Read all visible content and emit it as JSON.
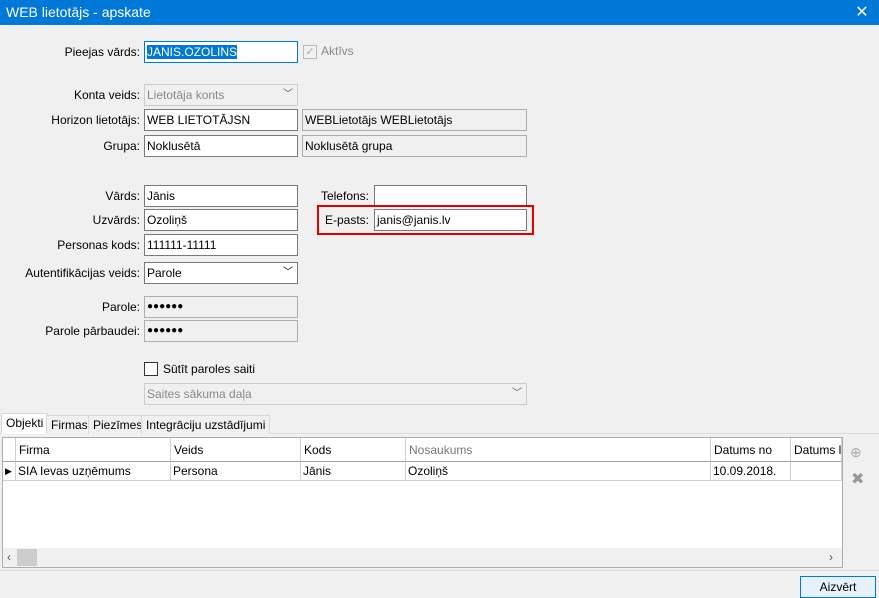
{
  "window": {
    "title": "WEB lietotājs - apskate",
    "close": "✕"
  },
  "form": {
    "login_label": "Pieejas vārds:",
    "login_value": "JANIS.OZOLINS",
    "active_label": "Aktīvs",
    "active_checked": true,
    "account_type_label": "Konta veids:",
    "account_type_value": "Lietotāja konts",
    "horizon_user_label": "Horizon lietotājs:",
    "horizon_user_value": "WEB LIETOTĀJSN",
    "horizon_user_name": "WEBLietotājs WEBLietotājs",
    "group_label": "Grupa:",
    "group_value": "Noklusētā",
    "group_name": "Noklusētā grupa",
    "first_name_label": "Vārds:",
    "first_name_value": "Jānis",
    "last_name_label": "Uzvārds:",
    "last_name_value": "Ozoliņš",
    "personal_code_label": "Personas kods:",
    "personal_code_value": "111111-11111",
    "auth_type_label": "Autentifikācijas veids:",
    "auth_type_value": "Parole",
    "password_label": "Parole:",
    "password_value": "●●●●●●",
    "password_confirm_label": "Parole pārbaudei:",
    "password_confirm_value": "●●●●●●",
    "phone_label": "Telefons:",
    "phone_value": "",
    "email_label": "E-pasts:",
    "email_value": "janis@janis.lv",
    "send_link_label": "Sūtīt paroles saiti",
    "send_link_checked": false,
    "start_page_placeholder": "Saites sākuma daļa"
  },
  "tabs": [
    "Objekti",
    "Firmas",
    "Piezīmes",
    "Integrāciju uzstādījumi"
  ],
  "grid": {
    "columns": [
      "Firma",
      "Veids",
      "Kods",
      "Nosaukums",
      "Datums no",
      "Datums līdz"
    ],
    "rows": [
      [
        "SIA Ievas uzņēmums",
        "Persona",
        "Jānis",
        "Ozoliņš",
        "10.09.2018.",
        ""
      ]
    ]
  },
  "footer": {
    "close_button": "Aizvērt"
  },
  "colors": {
    "titlebar": "#0078d7",
    "highlight": "#e00000"
  }
}
